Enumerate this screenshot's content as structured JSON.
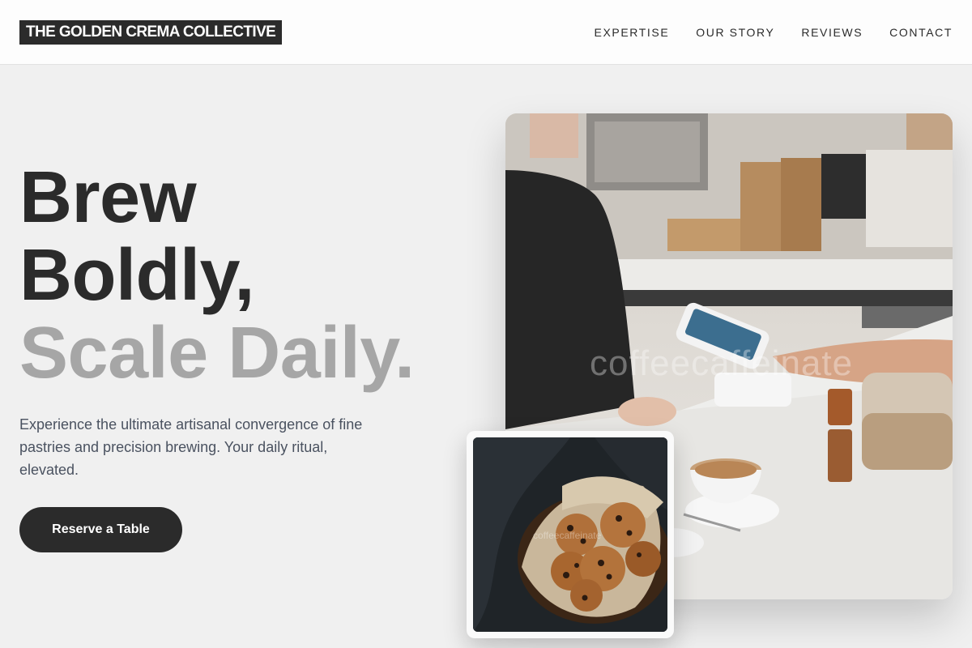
{
  "brand": {
    "name": "THE GOLDEN CREMA COLLECTIVE"
  },
  "nav": {
    "items": [
      {
        "label": "EXPERTISE"
      },
      {
        "label": "OUR STORY"
      },
      {
        "label": "REVIEWS"
      },
      {
        "label": "CONTACT"
      }
    ]
  },
  "hero": {
    "headline_line1": "Brew",
    "headline_line2": "Boldly,",
    "headline_line3": "Scale Daily.",
    "lead": "Experience the ultimate artisanal convergence of fine pastries and precision brewing. Your daily ritual, elevated.",
    "cta_label": "Reserve a Table"
  },
  "media": {
    "main_photo_watermark": "coffeecaffeinate",
    "secondary_photo_watermark": "coffeecaffeinate"
  },
  "colors": {
    "page_background": "#f0f0f0",
    "ink": "#2b2b2b",
    "muted_headline": "#a6a6a6",
    "lead_text": "#4a5260",
    "button_background": "#2b2b2b",
    "button_text": "#ffffff"
  }
}
